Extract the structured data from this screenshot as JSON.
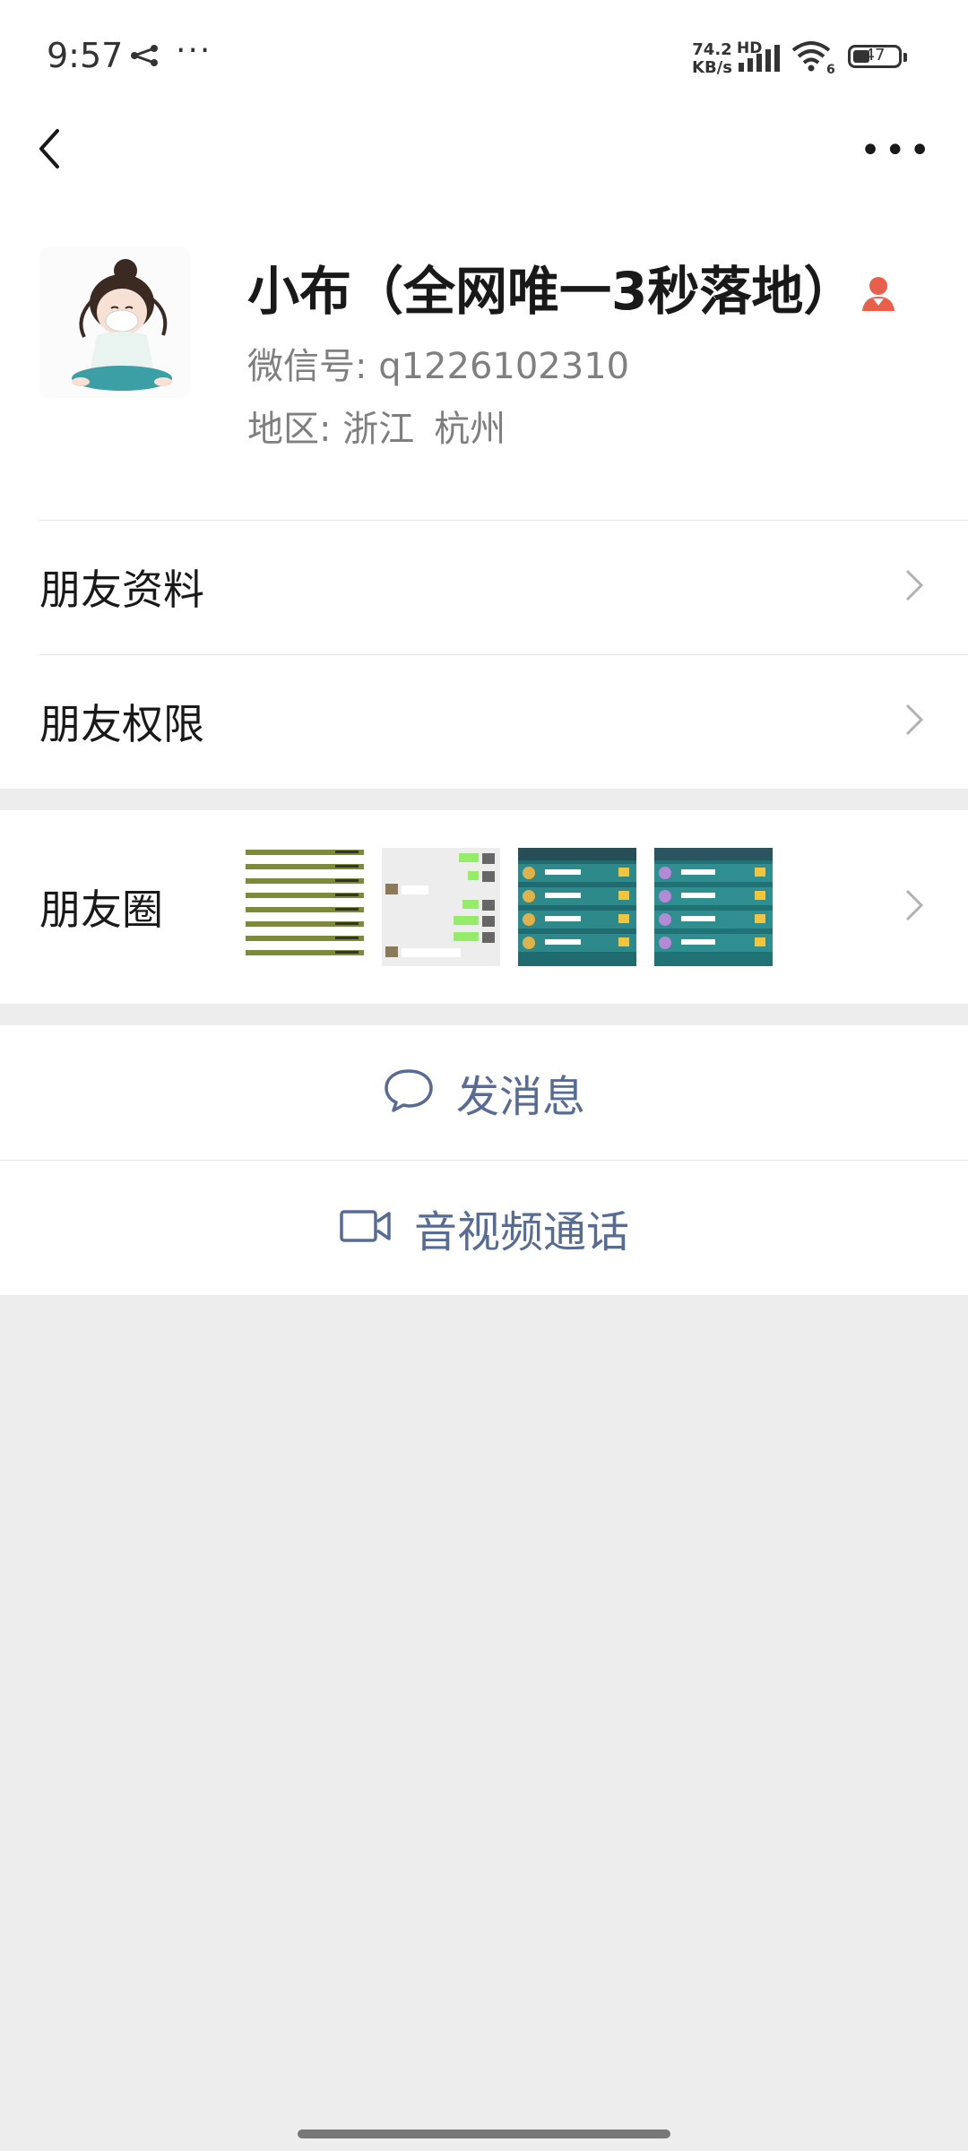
{
  "status_bar": {
    "time": "9:57",
    "speed_value": "74.2",
    "speed_unit": "KB/s",
    "network_label": "HD",
    "wifi_label": "6",
    "battery": "47"
  },
  "nav": {
    "back_icon": "chevron-left-icon",
    "more_icon": "more-dots-icon"
  },
  "profile": {
    "name": "小布（全网唯一3秒落地）",
    "wechat_id_label": "微信号:",
    "wechat_id": "q1226102310",
    "region_label": "地区:",
    "region_province": "浙江",
    "region_city": "杭州"
  },
  "rows": {
    "friend_info": "朋友资料",
    "friend_permissions": "朋友权限",
    "moments": "朋友圈"
  },
  "actions": {
    "message": "发消息",
    "call": "音视频通话"
  },
  "colors": {
    "link": "#576b95",
    "badge": "#e8604c",
    "background": "#ededed"
  }
}
